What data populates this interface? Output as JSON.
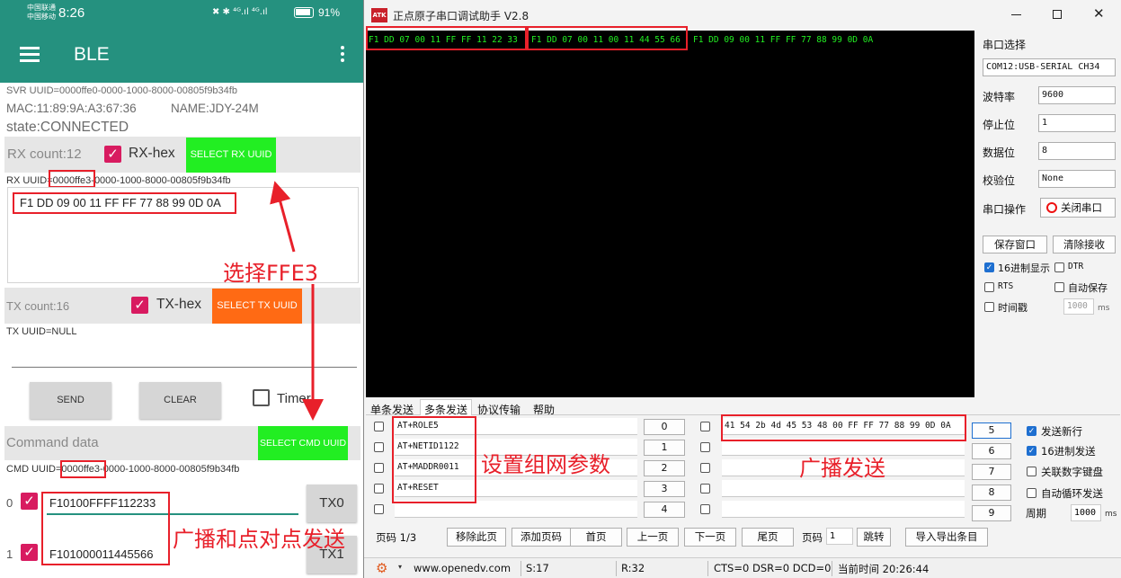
{
  "phone": {
    "status": {
      "carrier1": "中国联通",
      "carrier2": "中国移动",
      "time": "8:26",
      "indicators": "✖ ✱ ⁴ᴳ.ıl ⁴ᴳ.ıl",
      "battery": "91%"
    },
    "appbar": {
      "title": "BLE"
    },
    "svr_uuid": "SVR UUID=0000ffe0-0000-1000-8000-00805f9b34fb",
    "mac": "MAC:11:89:9A:A3:67:36",
    "name": "NAME:JDY-24M",
    "state": "state:CONNECTED",
    "rx": {
      "count": "RX count:12",
      "hex_label": "RX-hex",
      "select_btn": "SELECT RX UUID",
      "uuid_prefix": "RX UUID=",
      "uuid_highlight": "0000ffe3",
      "uuid_suffix": "-0000-1000-8000-00805f9b34fb",
      "data": "F1 DD 09 00 11 FF FF 77 88 99 0D 0A"
    },
    "tx": {
      "count": "TX count:16",
      "hex_label": "TX-hex",
      "select_btn": "SELECT TX UUID",
      "uuid": "TX UUID=NULL"
    },
    "buttons": {
      "send": "SEND",
      "clear": "CLEAR",
      "timer": "Timer"
    },
    "cmd": {
      "placeholder": "Command data",
      "select_btn": "SELECT CMD UUID",
      "uuid_prefix": "CMD UUID=",
      "uuid_highlight": "0000ffe3",
      "uuid_suffix": "-0000-1000-8000-00805f9b34fb"
    },
    "tx_rows": [
      {
        "index": "0",
        "value": "F10100FFFF112233",
        "button": "TX0"
      },
      {
        "index": "1",
        "value": "F101000011445566",
        "button": "TX1"
      }
    ]
  },
  "annotations": {
    "select_ffe3": "选择FFE3",
    "broadcast_p2p": "广播和点对点发送",
    "set_network": "设置组网参数",
    "broadcast_send": "广播发送"
  },
  "serial": {
    "logo": "ATK",
    "title": "正点原子串口调试助手 V2.8",
    "received": [
      "F1 DD 07 00 11 FF FF 11 22 33",
      "F1 DD 07 00 11 00 11 44 55 66",
      "F1 DD 09 00 11 FF FF 77 88 99 0D 0A"
    ],
    "settings": {
      "port_label": "串口选择",
      "port_value": "COM12:USB-SERIAL CH34",
      "baud_label": "波特率",
      "baud_value": "9600",
      "stop_label": "停止位",
      "stop_value": "1",
      "data_label": "数据位",
      "data_value": "8",
      "parity_label": "校验位",
      "parity_value": "None",
      "op_label": "串口操作",
      "op_button": "关闭串口"
    },
    "buttons": {
      "save_window": "保存窗口",
      "clear_recv": "清除接收"
    },
    "options": {
      "hex_display": "16进制显示",
      "dtr": "DTR",
      "rts": "RTS",
      "auto_save": "自动保存",
      "timestamp": "时间戳",
      "interval": "1000",
      "unit": "ms"
    },
    "tabs": [
      "单条发送",
      "多条发送",
      "协议传输",
      "帮助"
    ],
    "multi_rows": [
      {
        "cmd": "AT+ROLE5",
        "num": "0",
        "data": "41 54 2b 4d 45 53 48 00 FF FF 77 88 99 0D 0A",
        "num2": "5"
      },
      {
        "cmd": "AT+NETID1122",
        "num": "1",
        "data": "",
        "num2": "6"
      },
      {
        "cmd": "AT+MADDR0011",
        "num": "2",
        "data": "",
        "num2": "7"
      },
      {
        "cmd": "AT+RESET",
        "num": "3",
        "data": "",
        "num2": "8"
      },
      {
        "cmd": "",
        "num": "4",
        "data": "",
        "num2": "9"
      }
    ],
    "right_opts": {
      "newline": "发送新行",
      "hex_send": "16进制发送",
      "link_keypad": "关联数字键盘",
      "auto_loop": "自动循环发送",
      "period_label": "周期",
      "period_value": "1000",
      "period_unit": "ms"
    },
    "pager": {
      "page_label": "页码 1/3",
      "remove": "移除此页",
      "add": "添加页码",
      "first": "首页",
      "prev": "上一页",
      "next": "下一页",
      "last": "尾页",
      "page": "页码",
      "page_value": "1",
      "jump": "跳转",
      "import_export": "导入导出条目"
    },
    "statusbar": {
      "url": "www.openedv.com",
      "s": "S:17",
      "r": "R:32",
      "lines": "CTS=0 DSR=0 DCD=0",
      "time": "当前时间 20:26:44"
    }
  }
}
